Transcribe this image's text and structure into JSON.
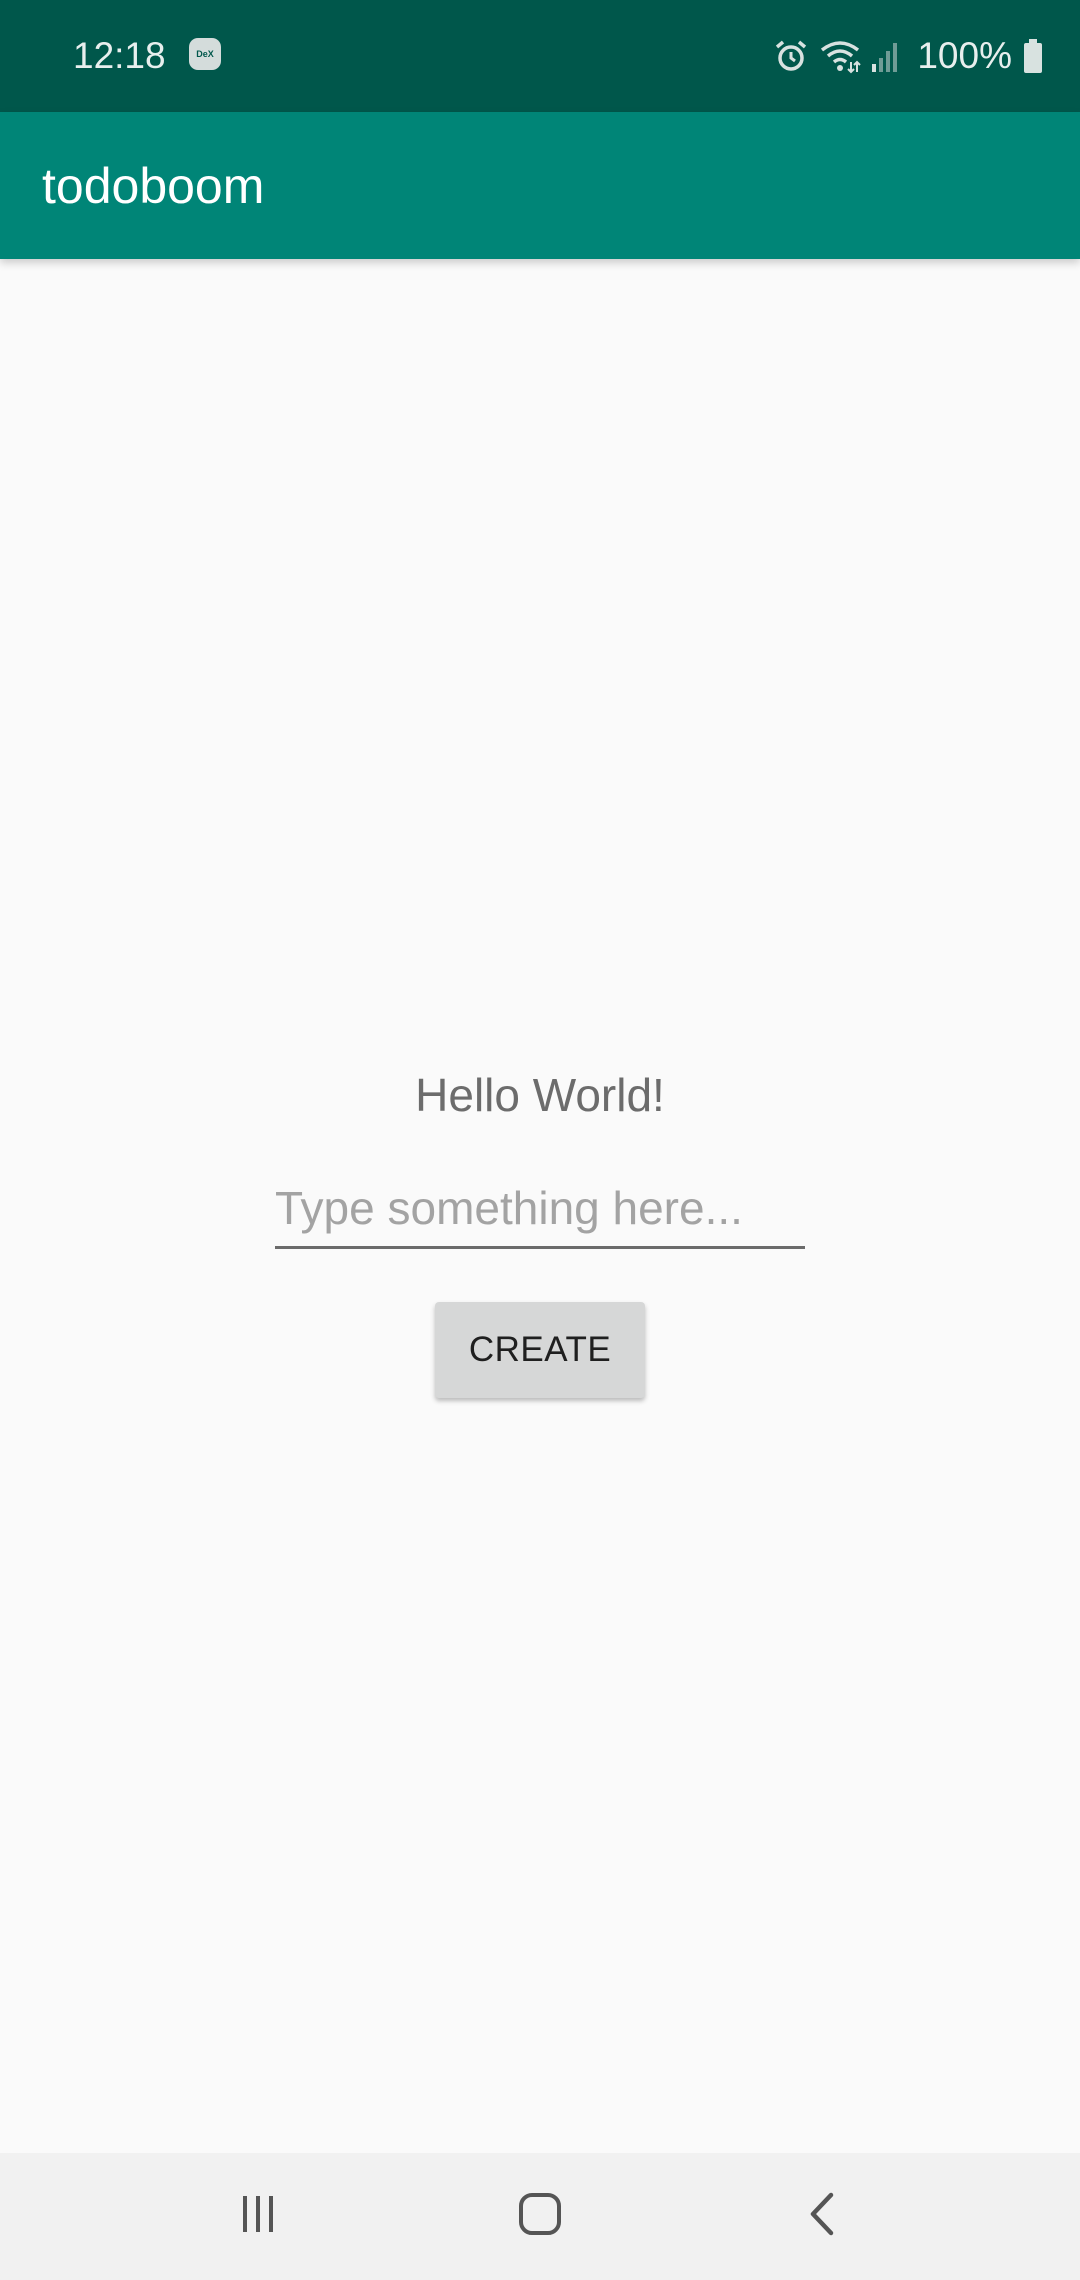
{
  "status_bar": {
    "time": "12:18",
    "dex_badge": "DeX",
    "battery_percent": "100%",
    "icons": [
      "dex-icon",
      "alarm-icon",
      "wifi-icon",
      "signal-icon",
      "battery-icon"
    ]
  },
  "app_bar": {
    "title": "todoboom"
  },
  "main": {
    "greeting": "Hello World!",
    "input": {
      "value": "",
      "placeholder": "Type something here..."
    },
    "create_button_label": "CREATE"
  },
  "nav_bar": {
    "icons": [
      "recent-apps-icon",
      "home-icon",
      "back-icon"
    ]
  },
  "colors": {
    "status_bar": "#00574b",
    "app_bar": "#008577",
    "background": "#fafafa",
    "nav_bar": "#f1f1f1",
    "button": "#d6d7d7"
  }
}
